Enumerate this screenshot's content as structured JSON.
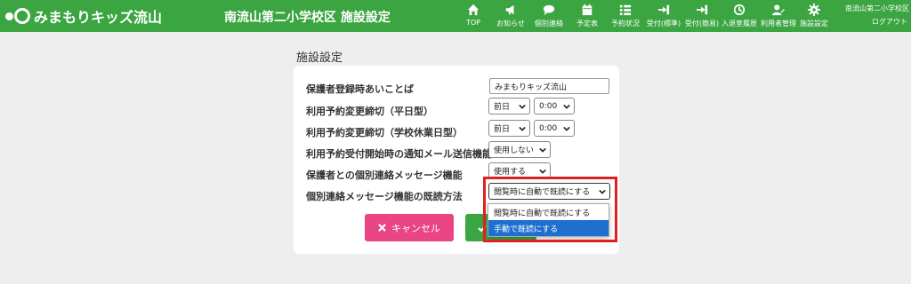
{
  "header": {
    "logo_text": "みまもりキッズ流山",
    "school_title": "南流山第二小学校区 施設設定",
    "user_school": "南流山第二小学校区",
    "logout": "ログアウト",
    "nav": [
      {
        "label": "TOP",
        "icon": "home-icon"
      },
      {
        "label": "お知らせ",
        "icon": "megaphone-icon"
      },
      {
        "label": "個別連絡",
        "icon": "chat-icon"
      },
      {
        "label": "予定表",
        "icon": "calendar-icon"
      },
      {
        "label": "予約状況",
        "icon": "list-icon"
      },
      {
        "label": "受付(標準)",
        "icon": "sign-in-icon"
      },
      {
        "label": "受付(簡易)",
        "icon": "sign-in-icon"
      },
      {
        "label": "入退室履歴",
        "icon": "history-icon"
      },
      {
        "label": "利用者管理",
        "icon": "user-edit-icon"
      },
      {
        "label": "施設設定",
        "icon": "gear-icon"
      }
    ]
  },
  "page": {
    "title": "施設設定"
  },
  "form": {
    "rows": [
      {
        "label": "保護者登録時あいことば"
      },
      {
        "label": "利用予約変更締切（平日型）"
      },
      {
        "label": "利用予約変更締切（学校休業日型）"
      },
      {
        "label": "利用予約受付開始時の通知メール送信機能"
      },
      {
        "label": "保護者との個別連絡メッセージ機能"
      },
      {
        "label": "個別連絡メッセージ機能の既読方法"
      }
    ],
    "passphrase_value": "みまもりキッズ流山",
    "weekday_day": "前日",
    "weekday_time": "0:00",
    "holiday_day": "前日",
    "holiday_time": "0:00",
    "notify_mail": "使用しない",
    "message_function": "使用する",
    "read_method": "閲覧時に自動で既読にする",
    "read_method_options": [
      "閲覧時に自動で既読にする",
      "手動で既読にする"
    ]
  },
  "buttons": {
    "cancel_label": "キャンセル"
  },
  "colors": {
    "header_bg": "#3aa541",
    "cancel_bg": "#e94585",
    "save_bg": "#3aa541",
    "option_selected": "#1f6fd1",
    "highlight": "#e02020"
  }
}
